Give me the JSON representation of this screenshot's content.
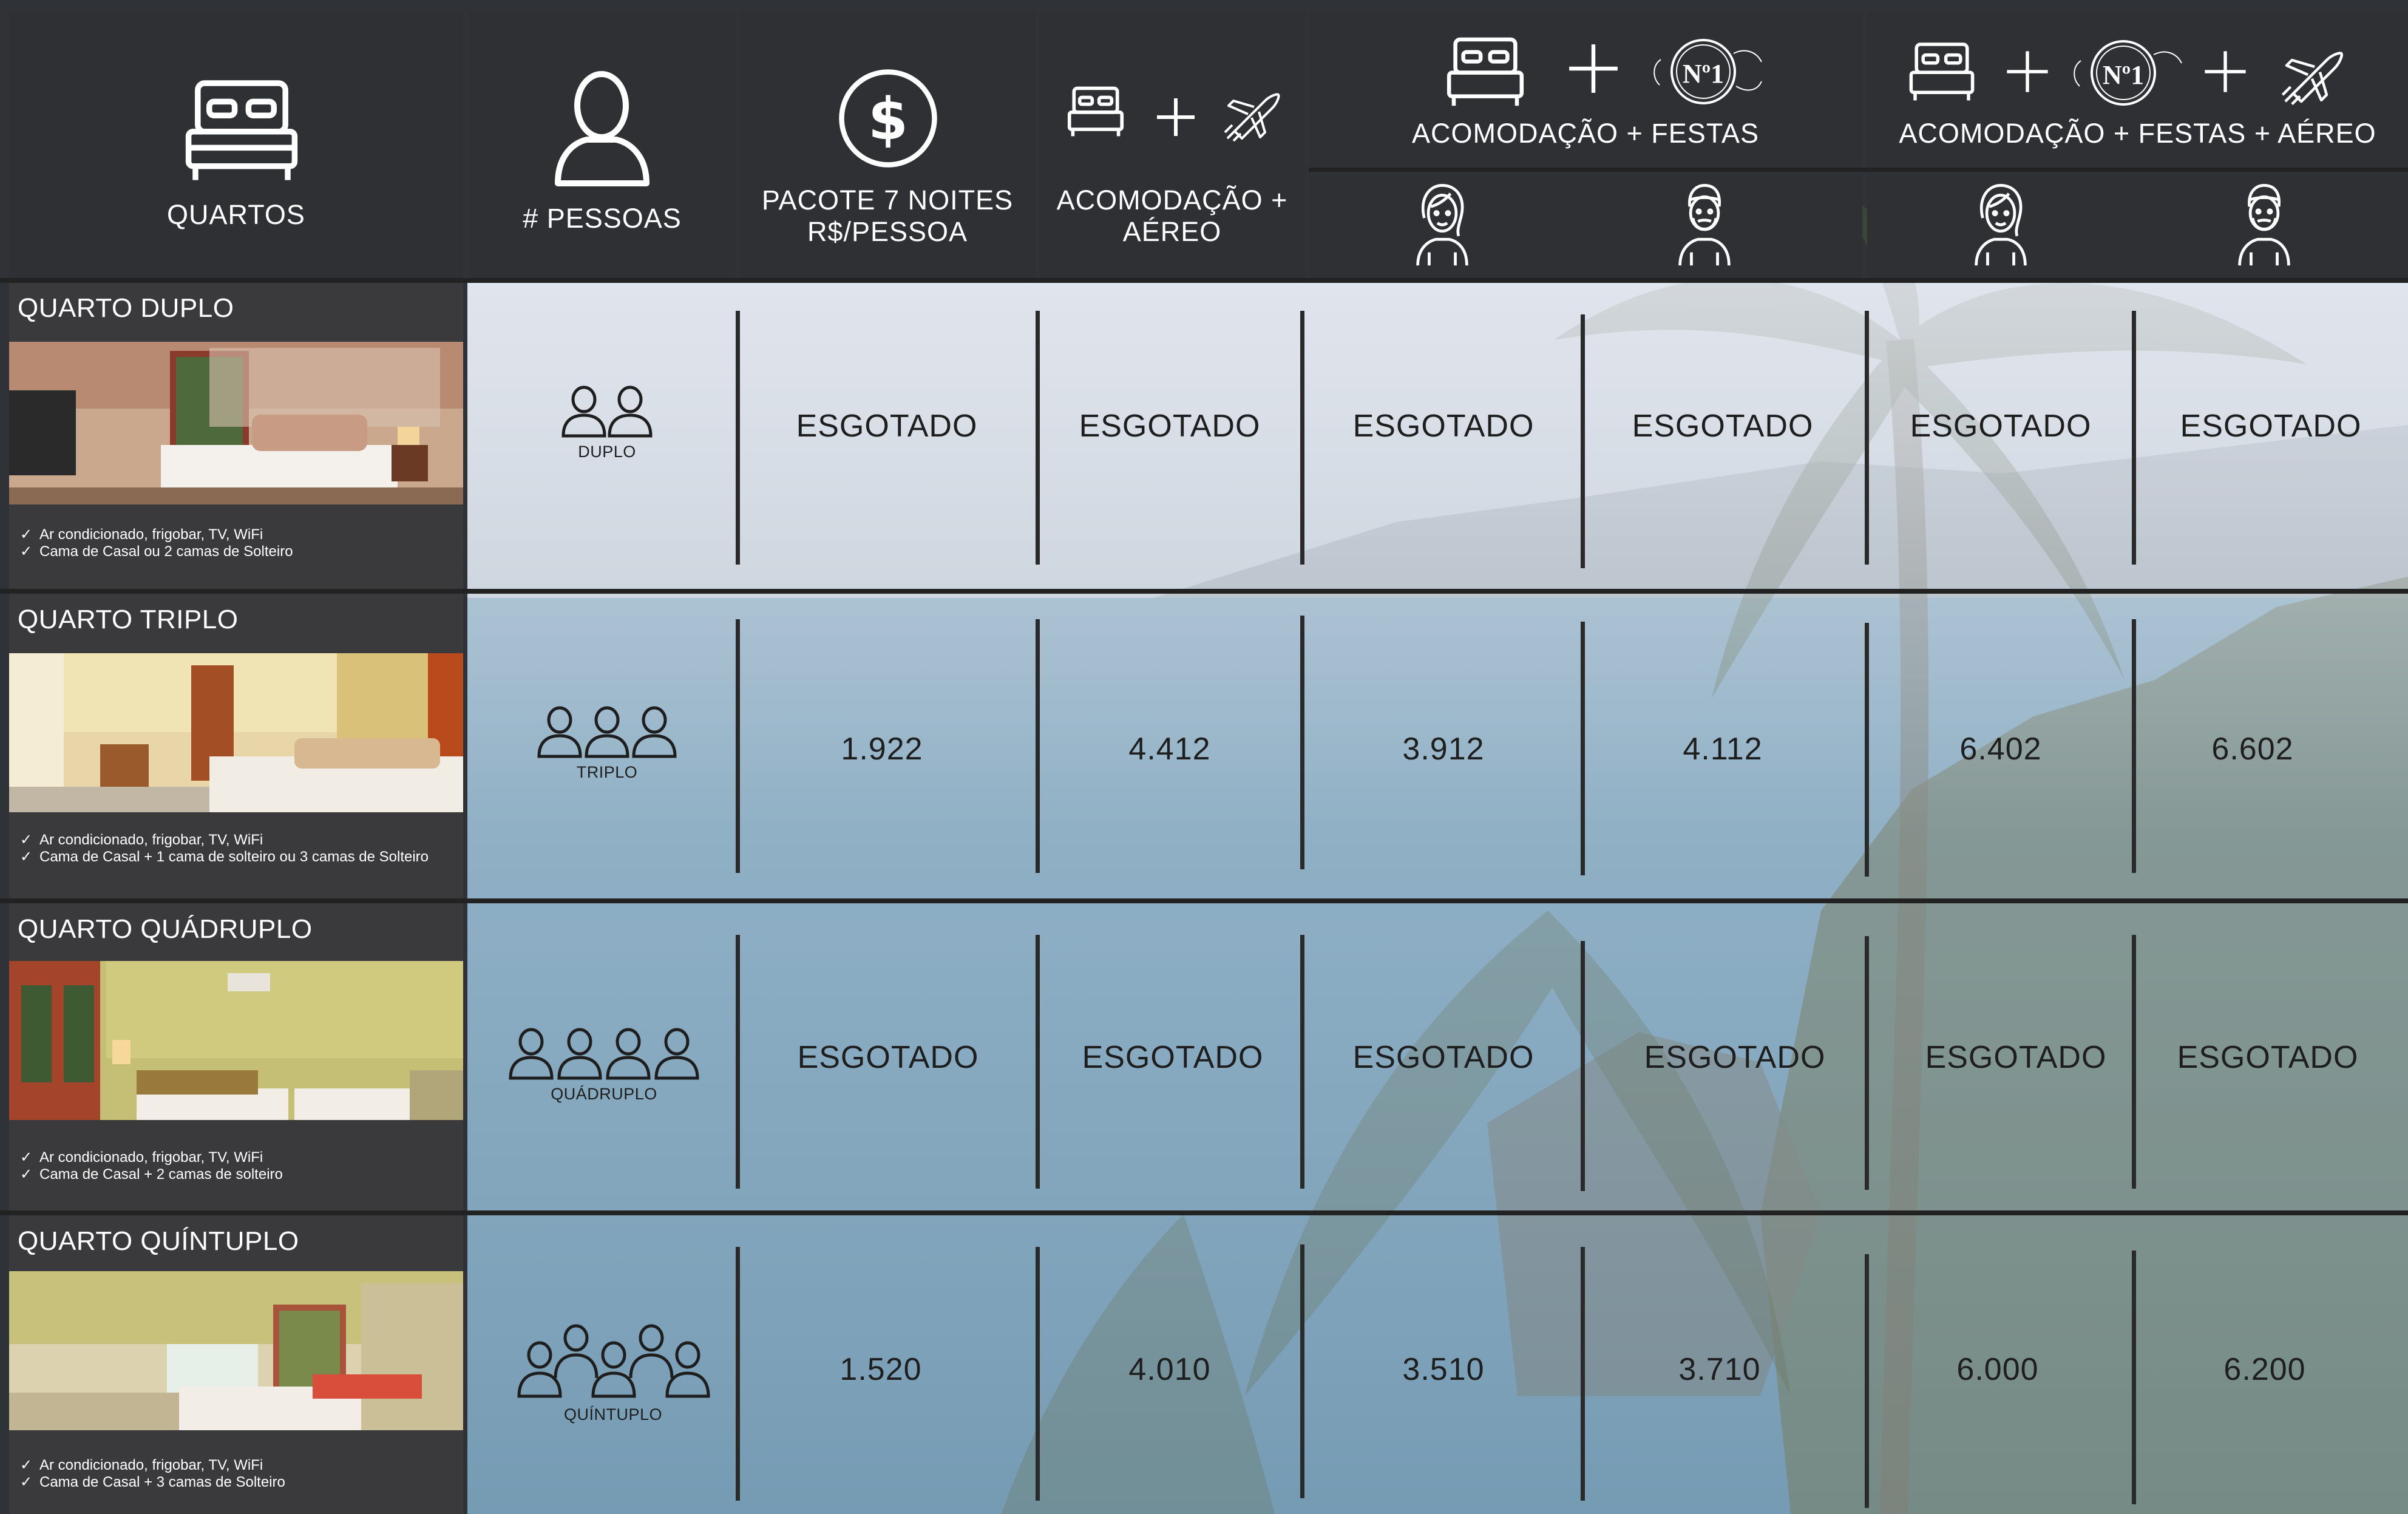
{
  "header": {
    "rooms": "QUARTOS",
    "people": "# PESSOAS",
    "package_line1": "PACOTE 7 NOITES",
    "package_line2": "R$/PESSOA",
    "acc_air_line1": "ACOMODAÇÃO +",
    "acc_air_line2": "AÉREO",
    "acc_parties": "ACOMODAÇÃO + FESTAS",
    "acc_parties_air": "ACOMODAÇÃO + FESTAS + AÉREO",
    "badge_text": "Nº1",
    "icons": {
      "rooms": "bed-icon",
      "people": "person-icon",
      "package": "dollar-icon",
      "acc_air": [
        "bed-icon",
        "plus-icon",
        "airplane-icon"
      ],
      "acc_parties": [
        "bed-icon",
        "plus-icon",
        "no1-badge-icon"
      ],
      "acc_parties_air": [
        "bed-icon",
        "plus-icon",
        "no1-badge-icon",
        "plus-icon",
        "airplane-icon"
      ],
      "gender": [
        "woman-icon",
        "man-icon"
      ]
    }
  },
  "rooms": [
    {
      "name": "QUARTO DUPLO",
      "features": [
        "Ar condicionado, frigobar, TV, WiFi",
        "Cama de Casal ou 2 camas de Solteiro"
      ],
      "people_label": "DUPLO",
      "people_count": 2,
      "values": [
        "ESGOTADO",
        "ESGOTADO",
        "ESGOTADO",
        "ESGOTADO",
        "ESGOTADO",
        "ESGOTADO"
      ]
    },
    {
      "name": "QUARTO TRIPLO",
      "features": [
        "Ar condicionado, frigobar, TV, WiFi",
        "Cama de Casal  + 1 cama de solteiro ou 3 camas de Solteiro"
      ],
      "people_label": "TRIPLO",
      "people_count": 3,
      "values": [
        "1.922",
        "4.412",
        "3.912",
        "4.112",
        "6.402",
        "6.602"
      ]
    },
    {
      "name": "QUARTO QUÁDRUPLO",
      "features": [
        "Ar condicionado, frigobar, TV, WiFi",
        "Cama de Casal  + 2 camas de solteiro"
      ],
      "people_label": "QUÁDRUPLO",
      "people_count": 4,
      "values": [
        "ESGOTADO",
        "ESGOTADO",
        "ESGOTADO",
        "ESGOTADO",
        "ESGOTADO",
        "ESGOTADO"
      ]
    },
    {
      "name": "QUARTO QUÍNTUPLO",
      "features": [
        "Ar condicionado, frigobar, TV, WiFi",
        "Cama de Casal  + 3 camas de Solteiro"
      ],
      "people_label": "QUÍNTUPLO",
      "people_count": 5,
      "values": [
        "1.520",
        "4.010",
        "3.510",
        "3.710",
        "6.000",
        "6.200"
      ]
    }
  ],
  "colors": {
    "header_bg": "#2e3034",
    "text_dark": "#1e1e1e",
    "text_light": "#ffffff",
    "grid_line": "#222222"
  }
}
